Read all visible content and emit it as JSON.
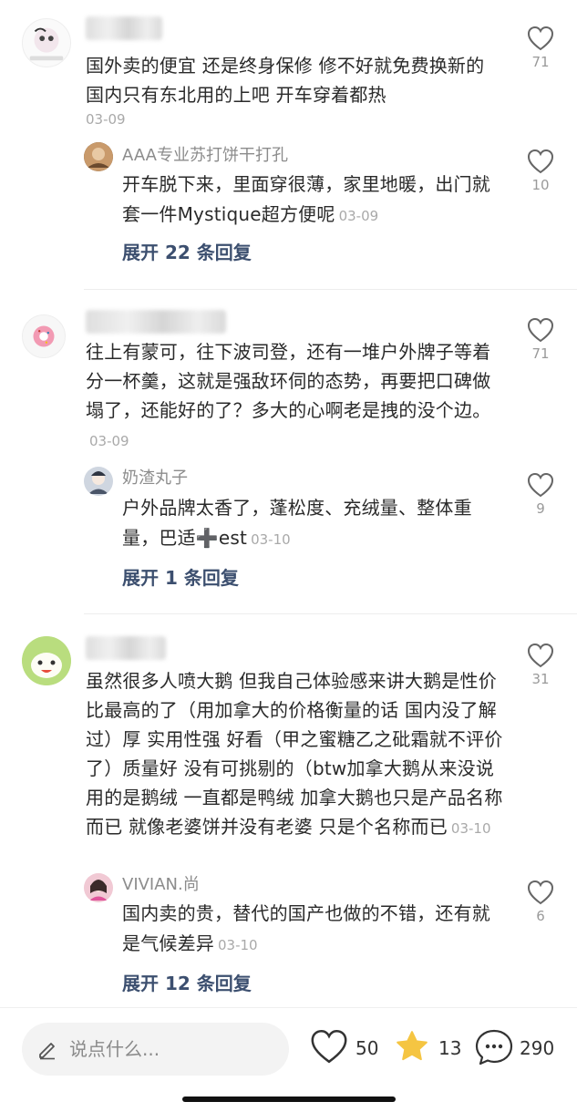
{
  "comments": [
    {
      "text": "国外卖的便宜 还是终身保修 修不好就免费换新的 国内只有东北用的上吧 开车穿着都热",
      "date": "03-09",
      "likes": "71",
      "reply": {
        "user": "AAA专业苏打饼干打孔",
        "text": "开车脱下来，里面穿很薄，家里地暖，出门就套一件Mystique超方便呢",
        "date": "03-09",
        "likes": "10"
      },
      "expand": "展开 22 条回复"
    },
    {
      "text": "往上有蒙可，往下波司登，还有一堆户外牌子等着分一杯羹，这就是强敌环伺的态势，再要把口碑做塌了，还能好的了？多大的心啊老是拽的没个边。",
      "date": "03-09",
      "likes": "71",
      "reply": {
        "user": "奶渣丸子",
        "text": "户外品牌太香了，蓬松度、充绒量、整体重量，巴适➕est",
        "date": "03-10",
        "likes": "9"
      },
      "expand": "展开 1 条回复"
    },
    {
      "text": "虽然很多人喷大鹅 但我自己体验感来讲大鹅是性价比最高的了（用加拿大的价格衡量的话 国内没了解过）厚 实用性强 好看（甲之蜜糖乙之砒霜就不评价了）质量好 没有可挑剔的（btw加拿大鹅从来没说用的是鹅绒 一直都是鸭绒 加拿大鹅也只是产品名称而已 就像老婆饼并没有老婆 只是个名称而已",
      "date": "03-10",
      "likes": "31",
      "reply": {
        "user": "VIVIAN.尚",
        "text": "国内卖的贵，替代的国产也做的不错，还有就是气候差异",
        "date": "03-10",
        "likes": "6"
      },
      "expand": "展开 12 条回复"
    }
  ],
  "bottom_bar": {
    "placeholder": "说点什么...",
    "likes": "50",
    "favorites": "13",
    "comments": "290"
  },
  "colors": {
    "expand": "#3c4f6f",
    "star": "#f5c542",
    "muted": "#a9a9a9"
  },
  "icons": [
    "heart-icon",
    "pencil-icon",
    "star-icon",
    "chat-bubble-icon"
  ]
}
